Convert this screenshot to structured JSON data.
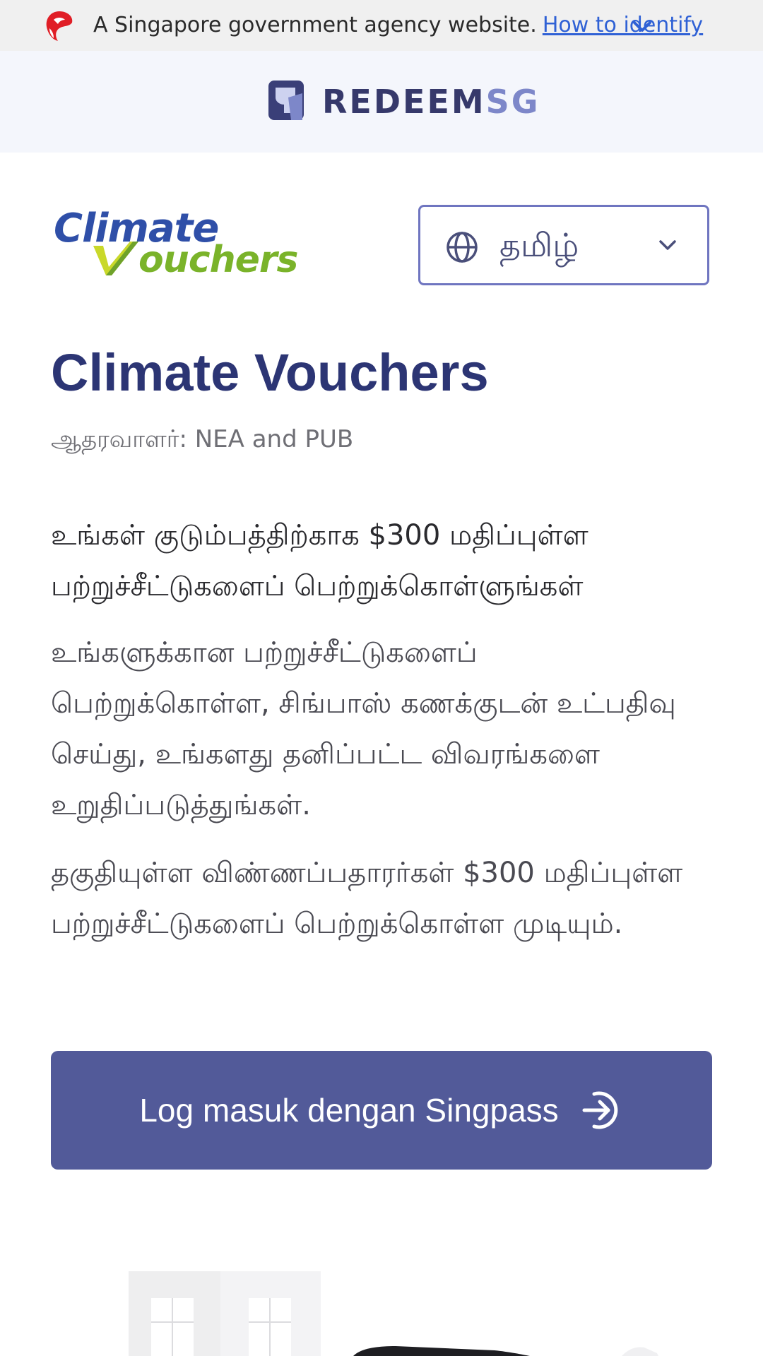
{
  "masthead": {
    "text": "A Singapore government agency website.",
    "link": "How to identify",
    "icons": {
      "logo": "merlion-lion-icon",
      "expand": "chevron-down-icon"
    },
    "colors": {
      "lion": "#e01e26",
      "link": "#2f61d5"
    }
  },
  "header": {
    "brand_main": "REDEEM",
    "brand_accent": "SG",
    "colors": {
      "brand_main": "#36396b",
      "brand_accent": "#7d87c9"
    }
  },
  "campaign_logo": {
    "line1": "Climate",
    "line2": "ouchers"
  },
  "language": {
    "selected": "தமிழ்",
    "icons": {
      "globe": "globe-icon",
      "dropdown": "chevron-down-icon"
    }
  },
  "main": {
    "title": "Climate Vouchers",
    "sponsor": "ஆதரவாளர்: NEA and PUB",
    "headline": "உங்கள் குடும்பத்திற்காக $300 மதிப்புள்ள பற்றுச்சீட்டுகளைப் பெற்றுக்கொள்ளுங்கள்",
    "paragraph_1": "உங்களுக்கான பற்றுச்சீட்டுகளைப் பெற்றுக்கொள்ள, சிங்பாஸ் கணக்குடன் உட்பதிவு செய்து, உங்களது தனிப்பட்ட விவரங்களை உறுதிப்படுத்துங்கள்.",
    "paragraph_2": "தகுதியுள்ள விண்ணப்பதாரர்கள் $300 மதிப்புள்ள பற்றுச்சீட்டுகளைப் பெற்றுக்கொள்ள முடியும்.",
    "login_button": "Log masuk dengan Singpass",
    "colors": {
      "title": "#2c3574",
      "button": "#525a99"
    }
  }
}
